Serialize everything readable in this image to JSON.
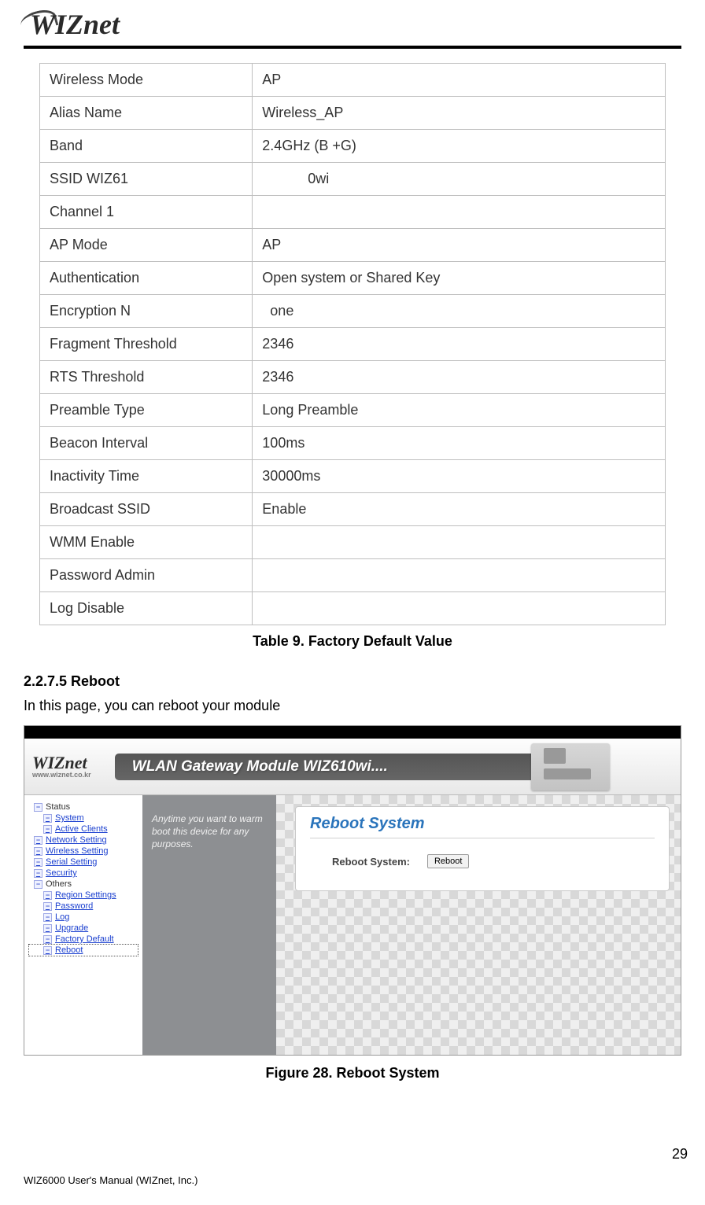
{
  "header": {
    "logo_text": "WIZnet"
  },
  "table": {
    "rows": [
      {
        "k": "Wireless Mode",
        "v": "AP"
      },
      {
        "k": "Alias Name",
        "v": "Wireless_AP"
      },
      {
        "k": "Band",
        "v": "2.4GHz (B +G)"
      },
      {
        "k": "SSID WIZ61",
        "v": "0wi"
      },
      {
        "k": "Channel 1",
        "v": ""
      },
      {
        "k": "AP Mode",
        "v": "AP"
      },
      {
        "k": "Authentication",
        "v": "Open system or Shared Key"
      },
      {
        "k": "Encryption N",
        "v": "one"
      },
      {
        "k": "Fragment Threshold",
        "v": "2346"
      },
      {
        "k": "RTS Threshold",
        "v": "2346"
      },
      {
        "k": "Preamble Type",
        "v": "Long Preamble"
      },
      {
        "k": "Beacon Interval",
        "v": "100ms"
      },
      {
        "k": "Inactivity Time",
        "v": "30000ms"
      },
      {
        "k": "Broadcast SSID",
        "v": "Enable"
      },
      {
        "k": "WMM Enable",
        "v": ""
      },
      {
        "k": "Password Admin",
        "v": ""
      },
      {
        "k": "Log Disable",
        "v": ""
      }
    ],
    "caption": "Table 9. Factory Default Value"
  },
  "section": {
    "heading": "2.2.7.5 Reboot",
    "body": "In this page, you can reboot your module"
  },
  "screenshot": {
    "banner_logo": "WIZnet",
    "banner_sub": "www.wiznet.co.kr",
    "banner_title": "WLAN Gateway Module WIZ610wi....",
    "nav": {
      "status": "Status",
      "system": "System",
      "active_clients": "Active Clients",
      "network_setting": "Network Setting",
      "wireless_setting": "Wireless Setting",
      "serial_setting": "Serial Setting",
      "security": "Security",
      "others": "Others",
      "region_settings": "Region Settings",
      "password": "Password",
      "log": "Log",
      "upgrade": "Upgrade",
      "factory_default": "Factory Default",
      "reboot": "Reboot"
    },
    "hint": "Anytime you want to warm boot this device for any purposes.",
    "panel_title": "Reboot System",
    "row_label": "Reboot System:",
    "button_label": "Reboot"
  },
  "figure_caption": "Figure 28. Reboot System",
  "page_number": "29",
  "footer": {
    "left": "WIZ6000 User's Manual",
    "company": "(WIZnet, Inc.)"
  }
}
